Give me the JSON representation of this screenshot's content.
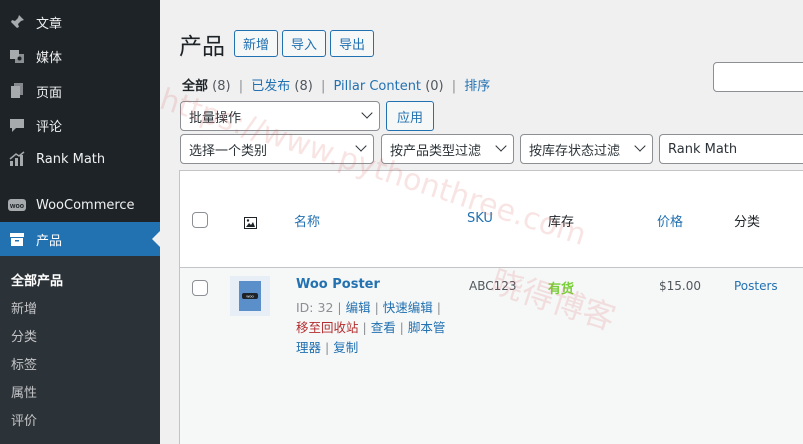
{
  "sidebar": {
    "items": [
      {
        "label": "文章",
        "icon": "pin-icon"
      },
      {
        "label": "媒体",
        "icon": "media-icon"
      },
      {
        "label": "页面",
        "icon": "pages-icon"
      },
      {
        "label": "评论",
        "icon": "comments-icon"
      },
      {
        "label": "Rank Math",
        "icon": "rank-math-icon"
      },
      {
        "label": "WooCommerce",
        "icon": "woo-icon"
      },
      {
        "label": "产品",
        "icon": "products-icon"
      }
    ],
    "submenu": [
      "全部产品",
      "新增",
      "分类",
      "标签",
      "属性",
      "评价"
    ]
  },
  "header": {
    "title": "产品",
    "buttons": [
      "新增",
      "导入",
      "导出"
    ]
  },
  "filters": {
    "views": [
      {
        "label": "全部",
        "count": "(8)"
      },
      {
        "label": "已发布",
        "count": "(8)"
      },
      {
        "label": "Pillar Content",
        "count": "(0)"
      },
      {
        "label": "排序",
        "count": ""
      }
    ],
    "bulk_action": "批量操作",
    "apply": "应用",
    "category": "选择一个类别",
    "product_type": "按产品类型过滤",
    "stock_status": "按库存状态过滤",
    "rank_math": "Rank Math"
  },
  "table": {
    "columns": [
      "名称",
      "SKU",
      "库存",
      "价格",
      "分类"
    ],
    "rows": [
      {
        "name": "Woo Poster",
        "id_text": "ID: 32",
        "actions": {
          "edit": "编辑",
          "quick_edit": "快速编辑",
          "trash": "移至回收站",
          "view": "查看",
          "script_manager": "脚本管理器",
          "duplicate": "复制"
        },
        "sku": "ABC123",
        "stock": "有货",
        "price": "$15.00",
        "category": "Posters"
      }
    ]
  },
  "watermark": {
    "line1": "https://www.pythonthree.com",
    "line2": "晓得博客"
  },
  "colors": {
    "sidebar_bg": "#1d2327",
    "accent": "#2271b1",
    "in_stock": "#7ad03a",
    "trash": "#b32d2e"
  }
}
